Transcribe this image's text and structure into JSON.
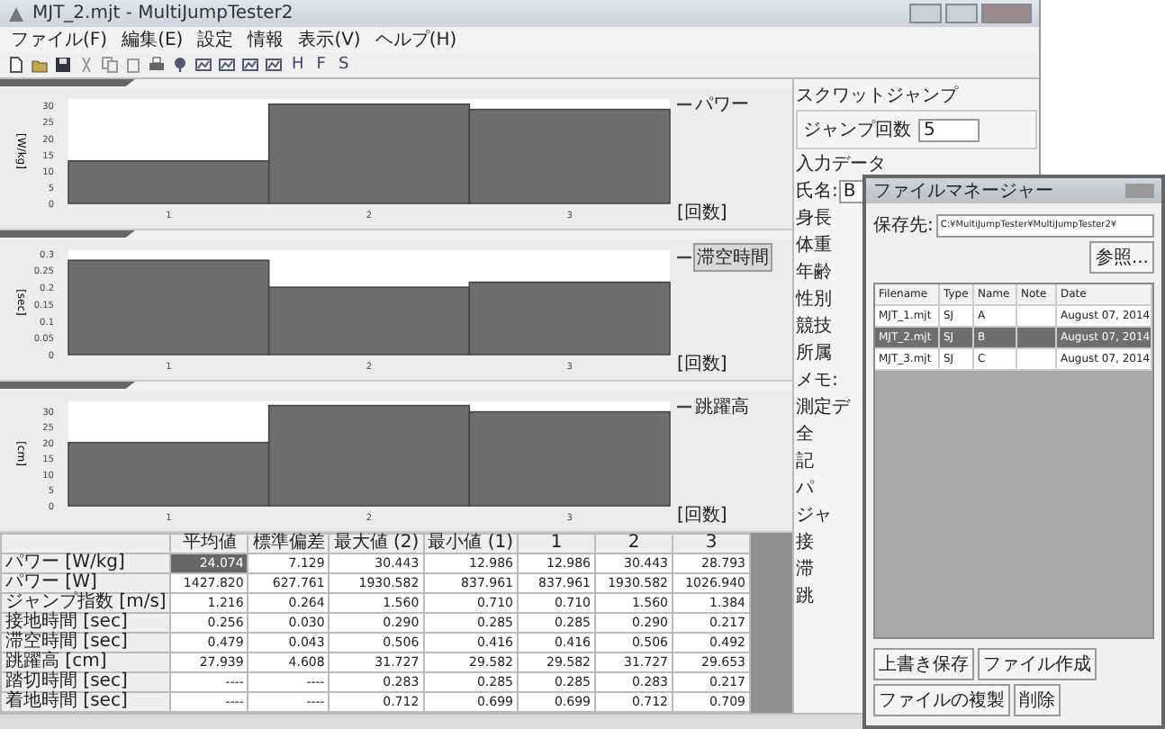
{
  "window": {
    "title": "MJT_2.mjt - MultiJumpTester2"
  },
  "menu": [
    "ファイル(F)",
    "編集(E)",
    "設定",
    "情報",
    "表示(V)",
    "ヘルプ(H)"
  ],
  "toolbar_letters": [
    "H",
    "F",
    "S"
  ],
  "charts": [
    {
      "highlighted": false,
      "chart_data": {
        "type": "bar",
        "ylabel": "[W/kg]",
        "xlabel": "[回数]",
        "categories": [
          "1",
          "2",
          "3"
        ],
        "series": [
          {
            "name": "パワー",
            "color": "#6e6e6e",
            "values": [
              13,
              30.4,
              28.8
            ]
          }
        ],
        "ylim": [
          0,
          32
        ],
        "yticks": [
          0,
          5,
          10,
          15,
          20,
          25,
          30
        ]
      }
    },
    {
      "highlighted": true,
      "chart_data": {
        "type": "bar",
        "ylabel": "[sec]",
        "xlabel": "[回数]",
        "categories": [
          "1",
          "2",
          "3"
        ],
        "series": [
          {
            "name": "滞空時間",
            "color": "#6e6e6e",
            "values": [
              0.28,
              0.2,
              0.215
            ]
          }
        ],
        "ylim": [
          0,
          0.31
        ],
        "yticks": [
          0,
          0.05,
          0.1,
          0.15,
          0.2,
          0.25,
          0.3
        ]
      }
    },
    {
      "highlighted": false,
      "chart_data": {
        "type": "bar",
        "ylabel": "[cm]",
        "xlabel": "[回数]",
        "categories": [
          "1",
          "2",
          "3"
        ],
        "series": [
          {
            "name": "跳躍高",
            "color": "#6e6e6e",
            "values": [
              20,
              31.7,
              29.7
            ]
          }
        ],
        "ylim": [
          0,
          33
        ],
        "yticks": [
          0,
          5,
          10,
          15,
          20,
          25,
          30
        ]
      }
    }
  ],
  "table": {
    "columns": [
      "平均値",
      "標準偏差",
      "最大値 (2)",
      "最小値 (1)",
      "1",
      "2",
      "3"
    ],
    "rows": [
      {
        "label": "パワー [W/kg]",
        "cells": [
          {
            "text": "24.074",
            "selected": true
          },
          {
            "text": "7.129",
            "selected": false
          },
          {
            "text": "30.443",
            "selected": false
          },
          {
            "text": "12.986",
            "selected": false
          },
          {
            "text": "12.986",
            "selected": false
          },
          {
            "text": "30.443",
            "selected": false
          },
          {
            "text": "28.793",
            "selected": false
          }
        ]
      },
      {
        "label": "パワー [W]",
        "cells": [
          {
            "text": "1427.820",
            "selected": false
          },
          {
            "text": "627.761",
            "selected": false
          },
          {
            "text": "1930.582",
            "selected": false
          },
          {
            "text": "837.961",
            "selected": false
          },
          {
            "text": "837.961",
            "selected": false
          },
          {
            "text": "1930.582",
            "selected": false
          },
          {
            "text": "1026.940",
            "selected": false
          }
        ]
      },
      {
        "label": "ジャンプ指数 [m/s]",
        "cells": [
          {
            "text": "1.216",
            "selected": false
          },
          {
            "text": "0.264",
            "selected": false
          },
          {
            "text": "1.560",
            "selected": false
          },
          {
            "text": "0.710",
            "selected": false
          },
          {
            "text": "0.710",
            "selected": false
          },
          {
            "text": "1.560",
            "selected": false
          },
          {
            "text": "1.384",
            "selected": false
          }
        ]
      },
      {
        "label": "接地時間 [sec]",
        "cells": [
          {
            "text": "0.256",
            "selected": false
          },
          {
            "text": "0.030",
            "selected": false
          },
          {
            "text": "0.290",
            "selected": false
          },
          {
            "text": "0.285",
            "selected": false
          },
          {
            "text": "0.285",
            "selected": false
          },
          {
            "text": "0.290",
            "selected": false
          },
          {
            "text": "0.217",
            "selected": false
          }
        ]
      },
      {
        "label": "滞空時間 [sec]",
        "cells": [
          {
            "text": "0.479",
            "selected": false
          },
          {
            "text": "0.043",
            "selected": false
          },
          {
            "text": "0.506",
            "selected": false
          },
          {
            "text": "0.416",
            "selected": false
          },
          {
            "text": "0.416",
            "selected": false
          },
          {
            "text": "0.506",
            "selected": false
          },
          {
            "text": "0.492",
            "selected": false
          }
        ]
      },
      {
        "label": "跳躍高 [cm]",
        "cells": [
          {
            "text": "27.939",
            "selected": false
          },
          {
            "text": "4.608",
            "selected": false
          },
          {
            "text": "31.727",
            "selected": false
          },
          {
            "text": "29.582",
            "selected": false
          },
          {
            "text": "29.582",
            "selected": false
          },
          {
            "text": "31.727",
            "selected": false
          },
          {
            "text": "29.653",
            "selected": false
          }
        ]
      },
      {
        "label": "踏切時間 [sec]",
        "cells": [
          {
            "text": "----",
            "selected": false
          },
          {
            "text": "----",
            "selected": false
          },
          {
            "text": "0.283",
            "selected": false
          },
          {
            "text": "0.285",
            "selected": false
          },
          {
            "text": "0.285",
            "selected": false
          },
          {
            "text": "0.283",
            "selected": false
          },
          {
            "text": "0.217",
            "selected": false
          }
        ]
      },
      {
        "label": "着地時間 [sec]",
        "cells": [
          {
            "text": "----",
            "selected": false
          },
          {
            "text": "----",
            "selected": false
          },
          {
            "text": "0.712",
            "selected": false
          },
          {
            "text": "0.699",
            "selected": false
          },
          {
            "text": "0.699",
            "selected": false
          },
          {
            "text": "0.712",
            "selected": false
          },
          {
            "text": "0.709",
            "selected": false
          }
        ]
      }
    ]
  },
  "panel": {
    "title": "スクワットジャンプ",
    "jump_count_label": "ジャンプ回数",
    "jump_count": "5",
    "input_group": "入力データ",
    "name_label": "氏名:",
    "name_value": "B",
    "input_labels": [
      "身長",
      "体重",
      "年齢",
      "性別",
      "競技",
      "所属",
      "メモ:"
    ],
    "result_group": "測定デ",
    "result_labels": [
      "全",
      "記",
      "パ",
      "ジャ",
      "接",
      "滞",
      "跳"
    ]
  },
  "dialog": {
    "title": "ファイルマネージャー",
    "path_label": "保存先:",
    "path": "C:¥MultiJumpTester¥MultiJumpTester2¥",
    "browse": "参照...",
    "columns": [
      "Filename",
      "Type",
      "Name",
      "Note",
      "Date"
    ],
    "files": [
      {
        "cells": [
          "MJT_1.mjt",
          "SJ",
          "A",
          "",
          "August 07, 2014"
        ],
        "selected": false
      },
      {
        "cells": [
          "MJT_2.mjt",
          "SJ",
          "B",
          "",
          "August 07, 2014"
        ],
        "selected": true
      },
      {
        "cells": [
          "MJT_3.mjt",
          "SJ",
          "C",
          "",
          "August 07, 2014"
        ],
        "selected": false
      }
    ],
    "buttons": [
      "上書き保存",
      "ファイル作成",
      "ファイルの複製",
      "削除"
    ]
  }
}
